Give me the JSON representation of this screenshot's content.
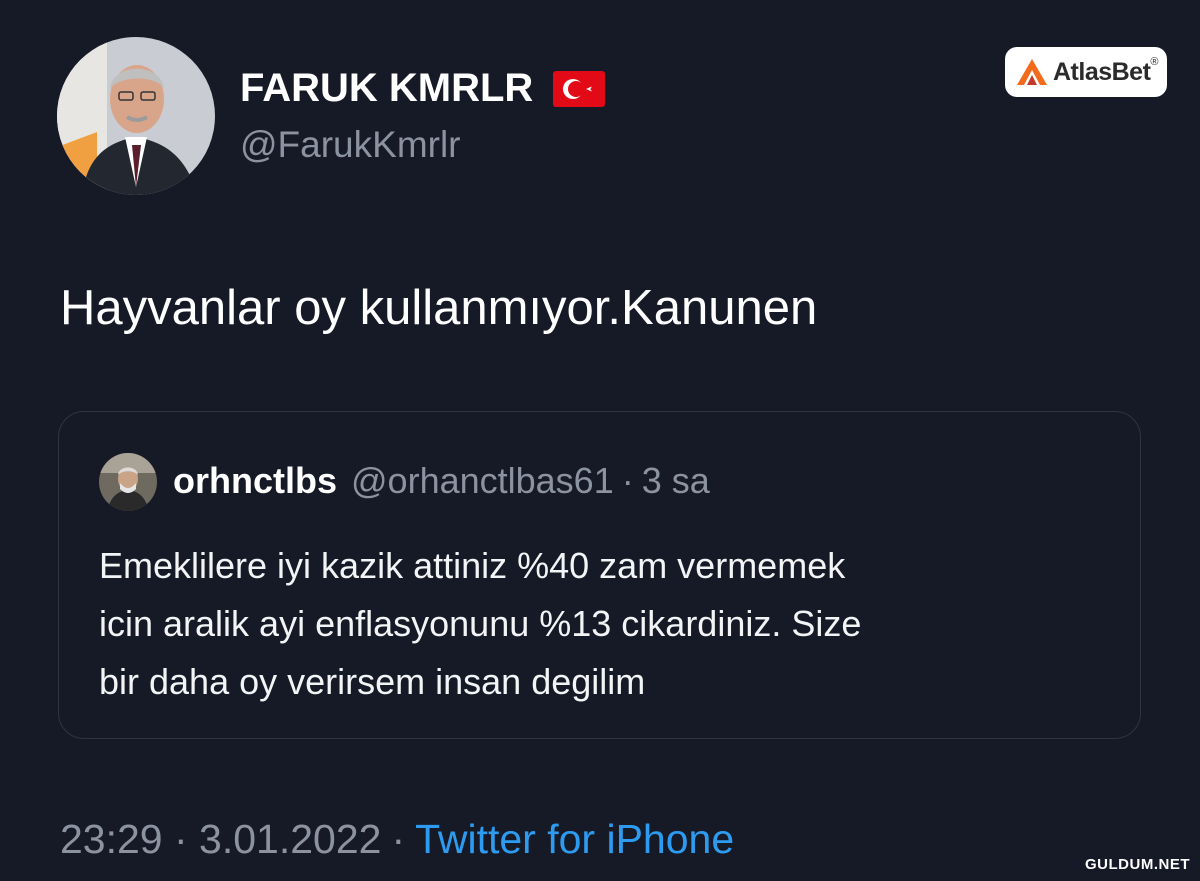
{
  "tweet": {
    "author_name": "FARUK KMRLR",
    "author_handle": "@FarukKmrlr",
    "flag_icon": "turkey-flag-icon",
    "text": "Hayvanlar oy kullanmıyor.Kanunen",
    "timestamp": "23:29 · 3.01.2022",
    "separator": "·",
    "source": "Twitter for iPhone"
  },
  "quoted_tweet": {
    "author_name": "orhnctlbs",
    "author_handle": "@orhanctlbas61",
    "separator": "·",
    "time": "3 sa",
    "text_lines": [
      "Emeklilere iyi kazik attiniz %40 zam vermemek",
      "icin aralik ayi enflasyonunu %13 cikardiniz. Size",
      "bir daha oy verirsem insan degilim"
    ]
  },
  "brand_badge": {
    "text": "AtlasBet",
    "reg_mark": "®"
  },
  "watermark": "GULDUM.NET",
  "colors": {
    "background": "#161a26",
    "text_primary": "#ffffff",
    "text_secondary": "#8b93a1",
    "link": "#2d9bf0",
    "card_border": "#2e3444",
    "flag_red": "#e30a17",
    "brand_orange": "#f26a1b"
  }
}
